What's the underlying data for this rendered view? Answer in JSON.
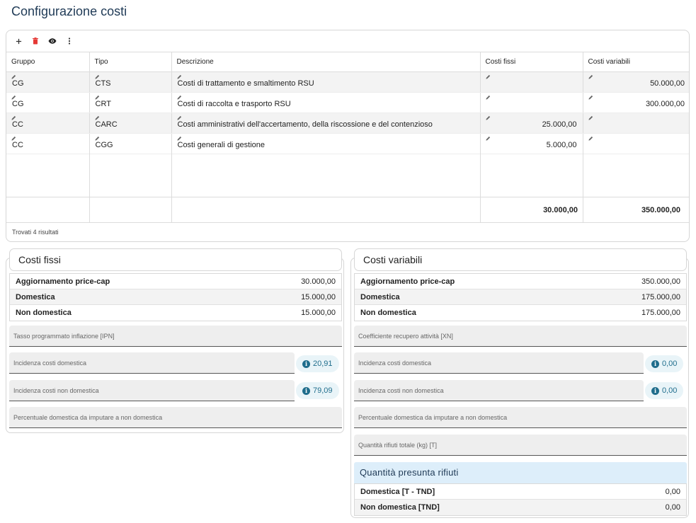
{
  "page": {
    "title": "Configurazione costi"
  },
  "grid": {
    "toolbar": {
      "add_icon": "plus-icon",
      "delete_icon": "trash-icon",
      "view_icon": "eye-icon",
      "more_icon": "more-vert-icon"
    },
    "columns": [
      "Gruppo",
      "Tipo",
      "Descrizione",
      "Costi fissi",
      "Costi variabili"
    ],
    "rows": [
      {
        "gruppo": "CG",
        "tipo": "CTS",
        "descrizione": "Costi di trattamento e smaltimento RSU",
        "fissi": "",
        "variabili": "50.000,00"
      },
      {
        "gruppo": "CG",
        "tipo": "CRT",
        "descrizione": "Costi di raccolta e trasporto RSU",
        "fissi": "",
        "variabili": "300.000,00"
      },
      {
        "gruppo": "CC",
        "tipo": "CARC",
        "descrizione": "Costi amministrativi dell'accertamento, della riscossione e del contenzioso",
        "fissi": "25.000,00",
        "variabili": ""
      },
      {
        "gruppo": "CC",
        "tipo": "CGG",
        "descrizione": "Costi generali di gestione",
        "fissi": "5.000,00",
        "variabili": ""
      }
    ],
    "totals": {
      "fissi": "30.000,00",
      "variabili": "350.000,00"
    },
    "found_text": "Trovati 4 risultati"
  },
  "fixed": {
    "title": "Costi fissi",
    "rows": [
      {
        "label": "Aggiornamento price-cap",
        "value": "30.000,00"
      },
      {
        "label": "Domestica",
        "value": "15.000,00"
      },
      {
        "label": "Non domestica",
        "value": "15.000,00"
      }
    ],
    "fields": {
      "ipn": "Tasso programmato inflazione [IPN]",
      "inc_dom": "Incidenza costi domestica",
      "inc_non_dom": "Incidenza costi non domestica",
      "perc": "Percentuale domestica da imputare a non domestica"
    },
    "chips": {
      "inc_dom": "20,91",
      "inc_non_dom": "79,09"
    }
  },
  "variable": {
    "title": "Costi variabili",
    "rows": [
      {
        "label": "Aggiornamento price-cap",
        "value": "350.000,00"
      },
      {
        "label": "Domestica",
        "value": "175.000,00"
      },
      {
        "label": "Non domestica",
        "value": "175.000,00"
      }
    ],
    "fields": {
      "xn": "Coefficiente recupero attività [XN]",
      "inc_dom": "Incidenza costi domestica",
      "inc_non_dom": "Incidenza costi non domestica",
      "perc": "Percentuale domestica da imputare a non domestica",
      "qty": "Quantità rifiuti totale (kg) [T]"
    },
    "chips": {
      "inc_dom": "0,00",
      "inc_non_dom": "0,00"
    },
    "presunta": {
      "title": "Quantità presunta rifiuti",
      "rows": [
        {
          "label": "Domestica [T - TND]",
          "value": "0,00"
        },
        {
          "label": "Non domestica [TND]",
          "value": "0,00"
        }
      ]
    }
  },
  "colors": {
    "title": "#1f3a56",
    "accent": "#1f6d8c",
    "delete": "#e53935",
    "chip_bg": "#e9f4f8",
    "sub_head_bg": "#ddeefa"
  }
}
